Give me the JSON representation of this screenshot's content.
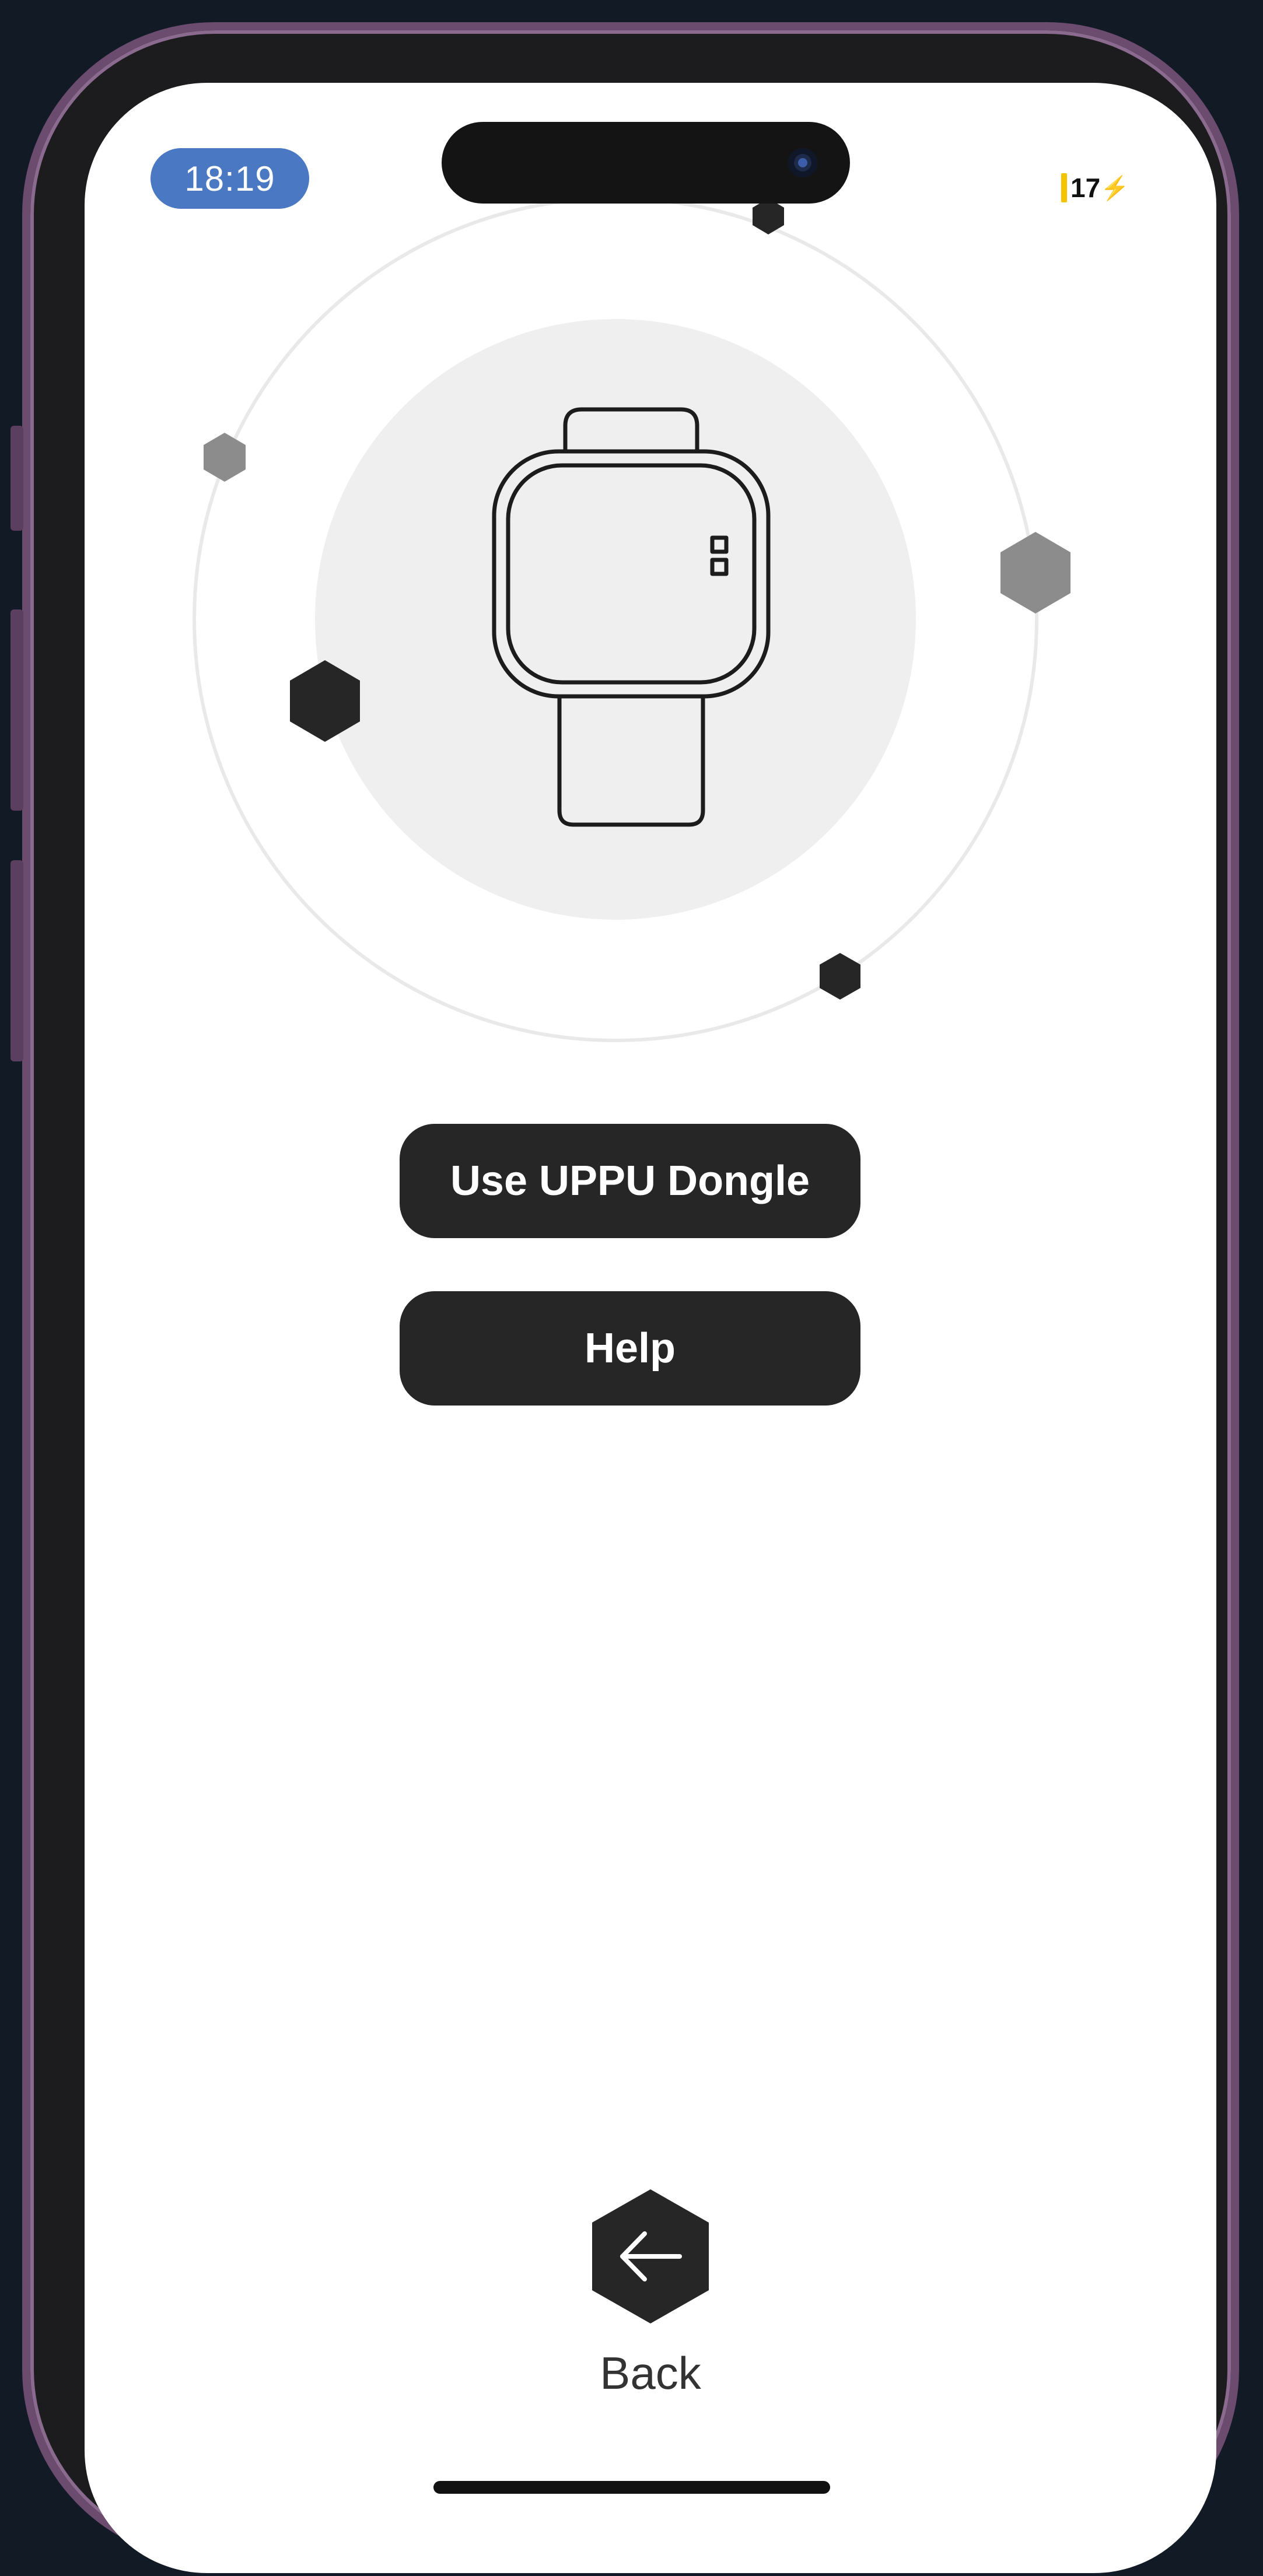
{
  "status_bar": {
    "time": "18:19",
    "battery": "17",
    "battery_glyph": "⚡"
  },
  "main": {
    "illustration_icon": "smartwatch-icon",
    "buttons": [
      {
        "label": "Use UPPU Dongle"
      },
      {
        "label": "Help"
      }
    ]
  },
  "footer": {
    "back_label": "Back",
    "back_icon": "arrow-left-icon"
  },
  "colors": {
    "time_pill": "#4a78c2",
    "button_bg": "#262626",
    "hex_dark": "#262626",
    "hex_grey": "#8c8c8c",
    "orbit_fill": "#efefef",
    "battery": "#f5c400",
    "frame": "#6b4b6e"
  }
}
